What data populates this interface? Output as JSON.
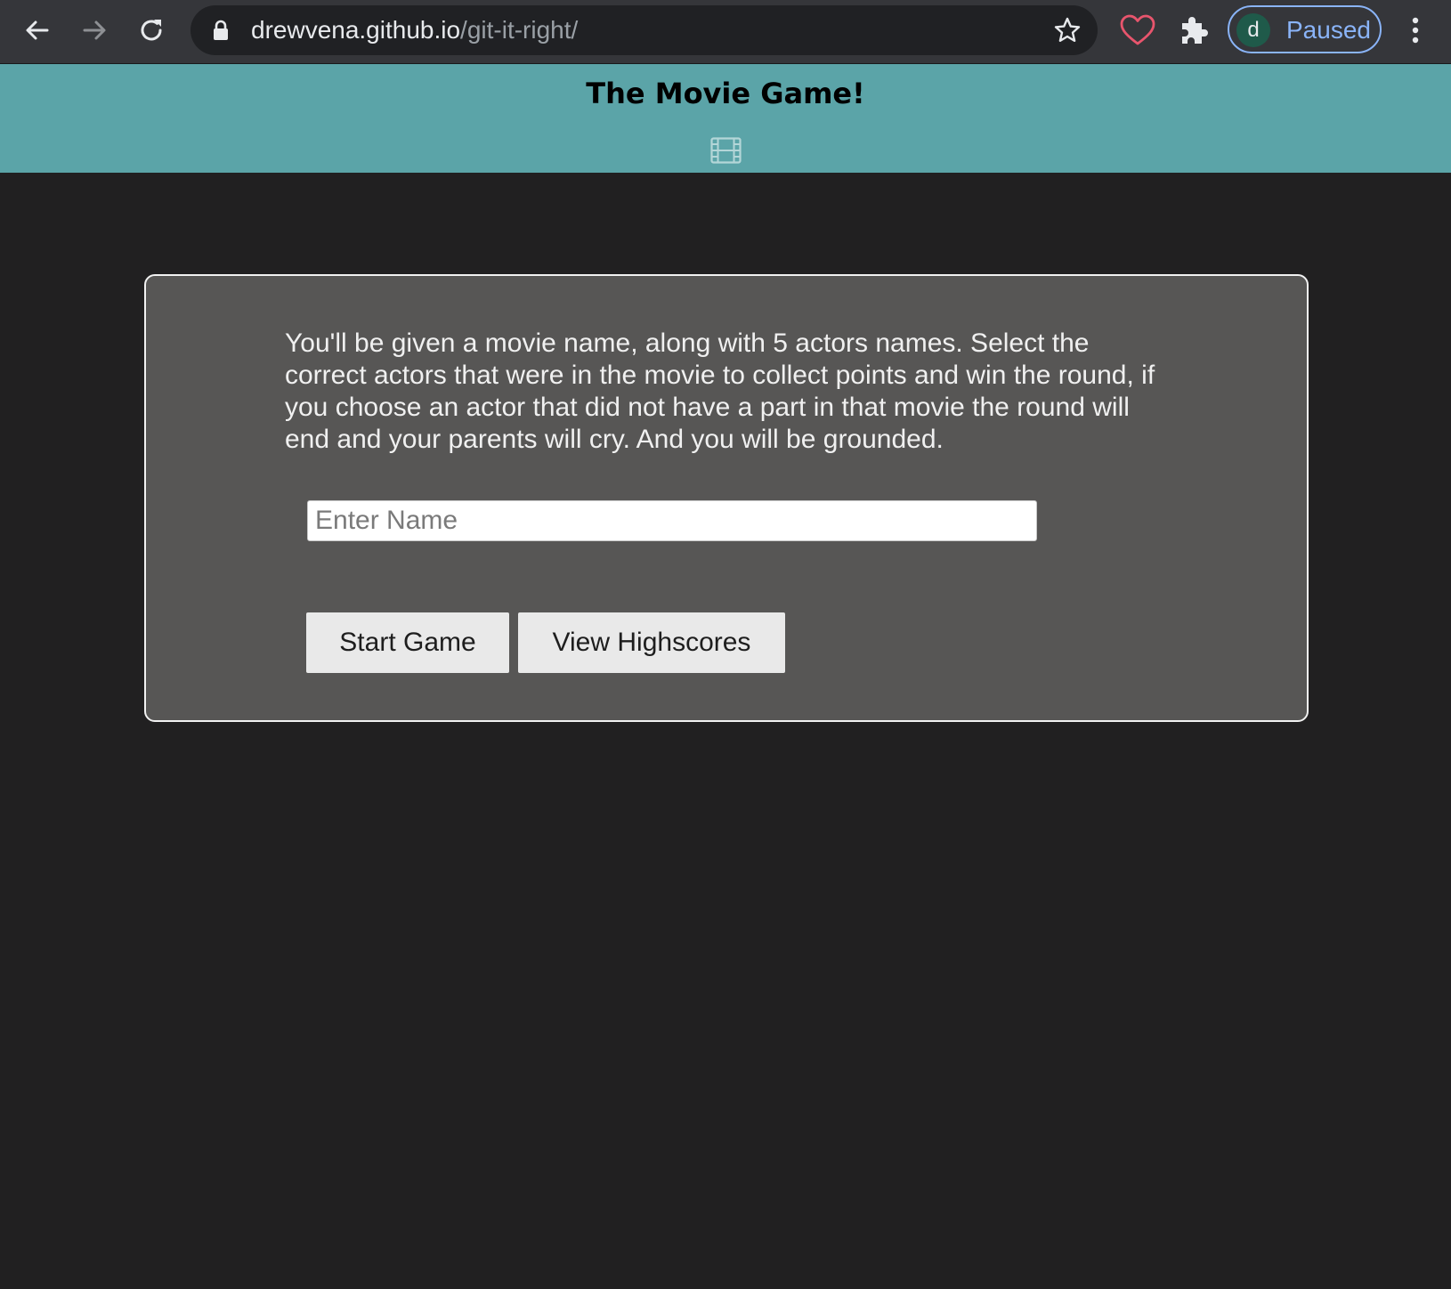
{
  "browser": {
    "url_host": "drewvena.github.io",
    "url_path": "/git-it-right/",
    "profile_initial": "d",
    "profile_status": "Paused",
    "accent_color": "#8ab4f8"
  },
  "icons": {
    "back": "back-arrow-icon",
    "forward": "forward-arrow-icon",
    "reload": "reload-icon",
    "lock": "lock-icon",
    "bookmark": "star-icon",
    "extension_heart": "heart-icon",
    "extensions": "puzzle-icon",
    "menu": "kebab-menu-icon",
    "header": "film-icon"
  },
  "header": {
    "title": "The Movie Game!",
    "background_color": "#5ba4a8"
  },
  "main": {
    "instructions": "You'll be given a movie name, along with 5 actors names. Select the correct actors that were in the movie to collect points and win the round, if you choose an actor that did not have a part in that movie the round will end and your parents will cry. And you will be grounded.",
    "name_input": {
      "placeholder": "Enter Name",
      "value": ""
    },
    "start_button_label": "Start Game",
    "highscores_button_label": "View Highscores"
  }
}
